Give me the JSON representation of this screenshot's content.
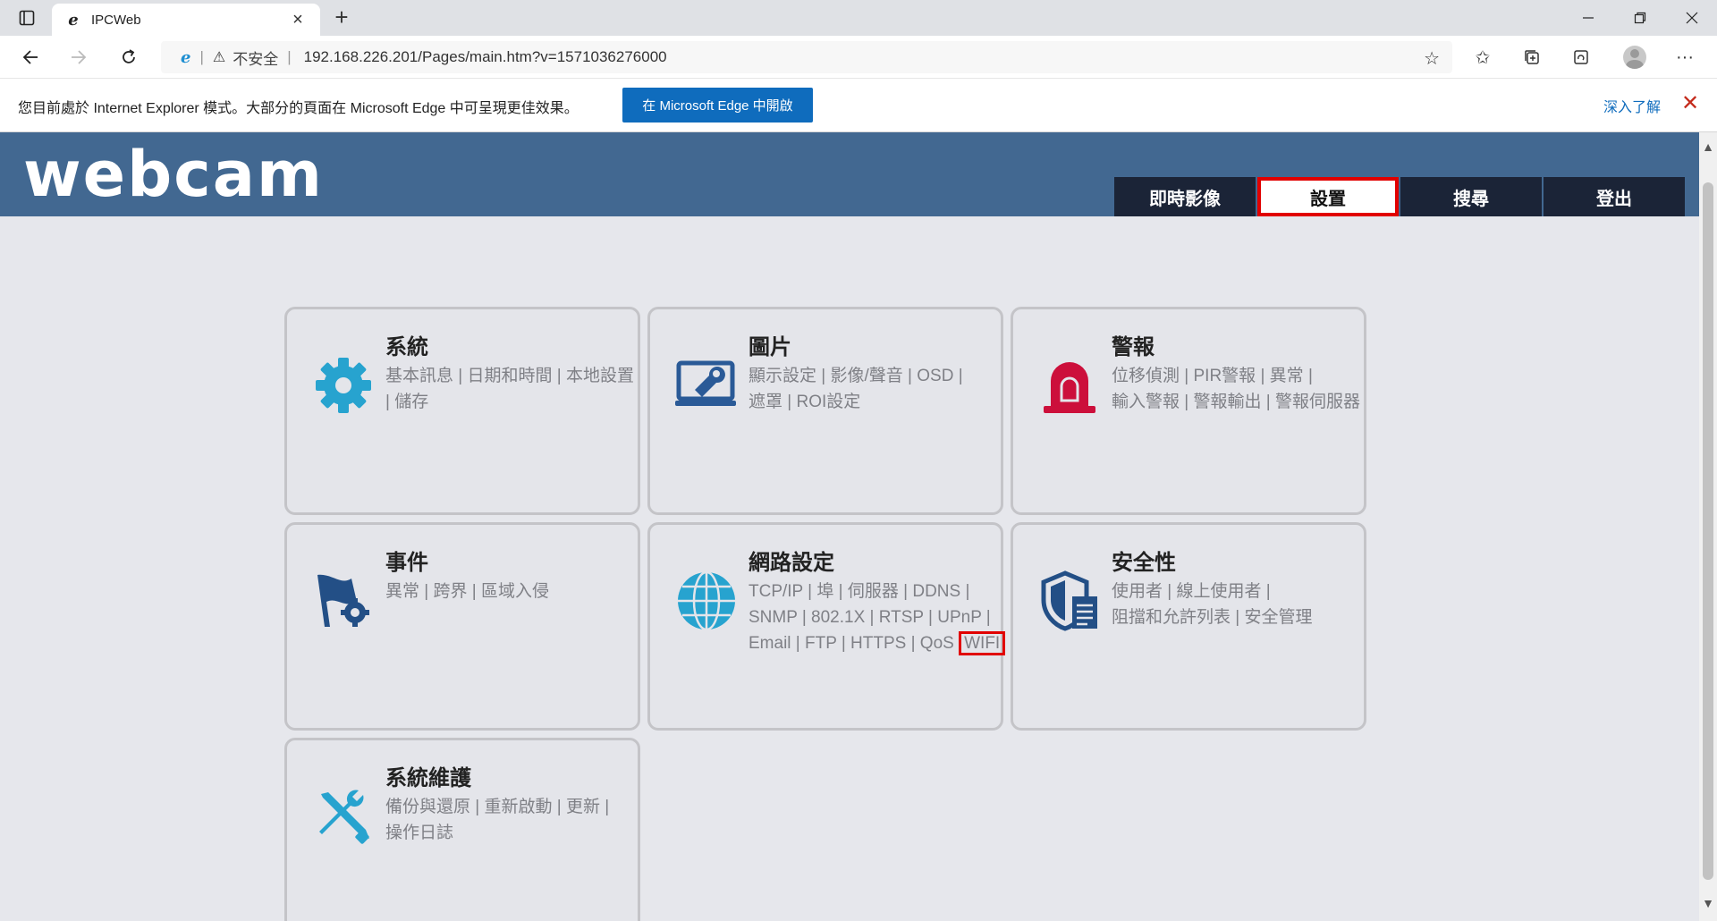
{
  "browser": {
    "tab_title": "IPCWeb",
    "new_tab_label": "+",
    "address": {
      "security_label": "不安全",
      "url": "192.168.226.201/Pages/main.htm?v=1571036276000"
    }
  },
  "infobar": {
    "message": "您目前處於 Internet Explorer 模式。大部分的頁面在 Microsoft Edge 中可呈現更佳效果。",
    "open_button": "在 Microsoft Edge 中開啟",
    "learn_more": "深入了解"
  },
  "site": {
    "logo": "webcam",
    "menu": [
      {
        "label": "即時影像",
        "active": false
      },
      {
        "label": "設置",
        "active": true
      },
      {
        "label": "搜尋",
        "active": false
      },
      {
        "label": "登出",
        "active": false
      }
    ]
  },
  "cards": [
    {
      "title": "系統",
      "desc": [
        "基本訊息 | 日期和時間 | 本地設置",
        " | 儲存"
      ],
      "icon": "gear-icon",
      "color": "#27a3cf"
    },
    {
      "title": "圖片",
      "desc": [
        "顯示設定 | 影像/聲音 | OSD |",
        "遮罩 | ROI設定"
      ],
      "icon": "monitor-wrench-icon",
      "color": "#2a5a97"
    },
    {
      "title": "警報",
      "desc": [
        "位移偵測 | PIR警報 | 異常 |",
        "輸入警報 | 警報輸出 | 警報伺服器"
      ],
      "icon": "alarm-light-icon",
      "color": "#cc0f3b"
    },
    {
      "title": "事件",
      "desc": [
        "異常 | 跨界 | 區域入侵"
      ],
      "icon": "flag-gear-icon",
      "color": "#234f86"
    },
    {
      "title": "網路設定",
      "desc": [
        "TCP/IP | 埠 | 伺服器 | DDNS |",
        "SNMP | 802.1X | RTSP | UPnP |",
        "Email | FTP | HTTPS | QoS"
      ],
      "desc_extra": "WIFI",
      "icon": "globe-icon",
      "color": "#27a3cf"
    },
    {
      "title": "安全性",
      "desc": [
        "使用者 | 線上使用者 |",
        "阻擋和允許列表 | 安全管理"
      ],
      "icon": "shield-document-icon",
      "color": "#234f86"
    },
    {
      "title": "系統維護",
      "desc": [
        "備份與還原 | 重新啟動 | 更新 |",
        "操作日誌"
      ],
      "icon": "tools-icon",
      "color": "#27a3cf"
    }
  ],
  "highlight_color": "#e10000"
}
